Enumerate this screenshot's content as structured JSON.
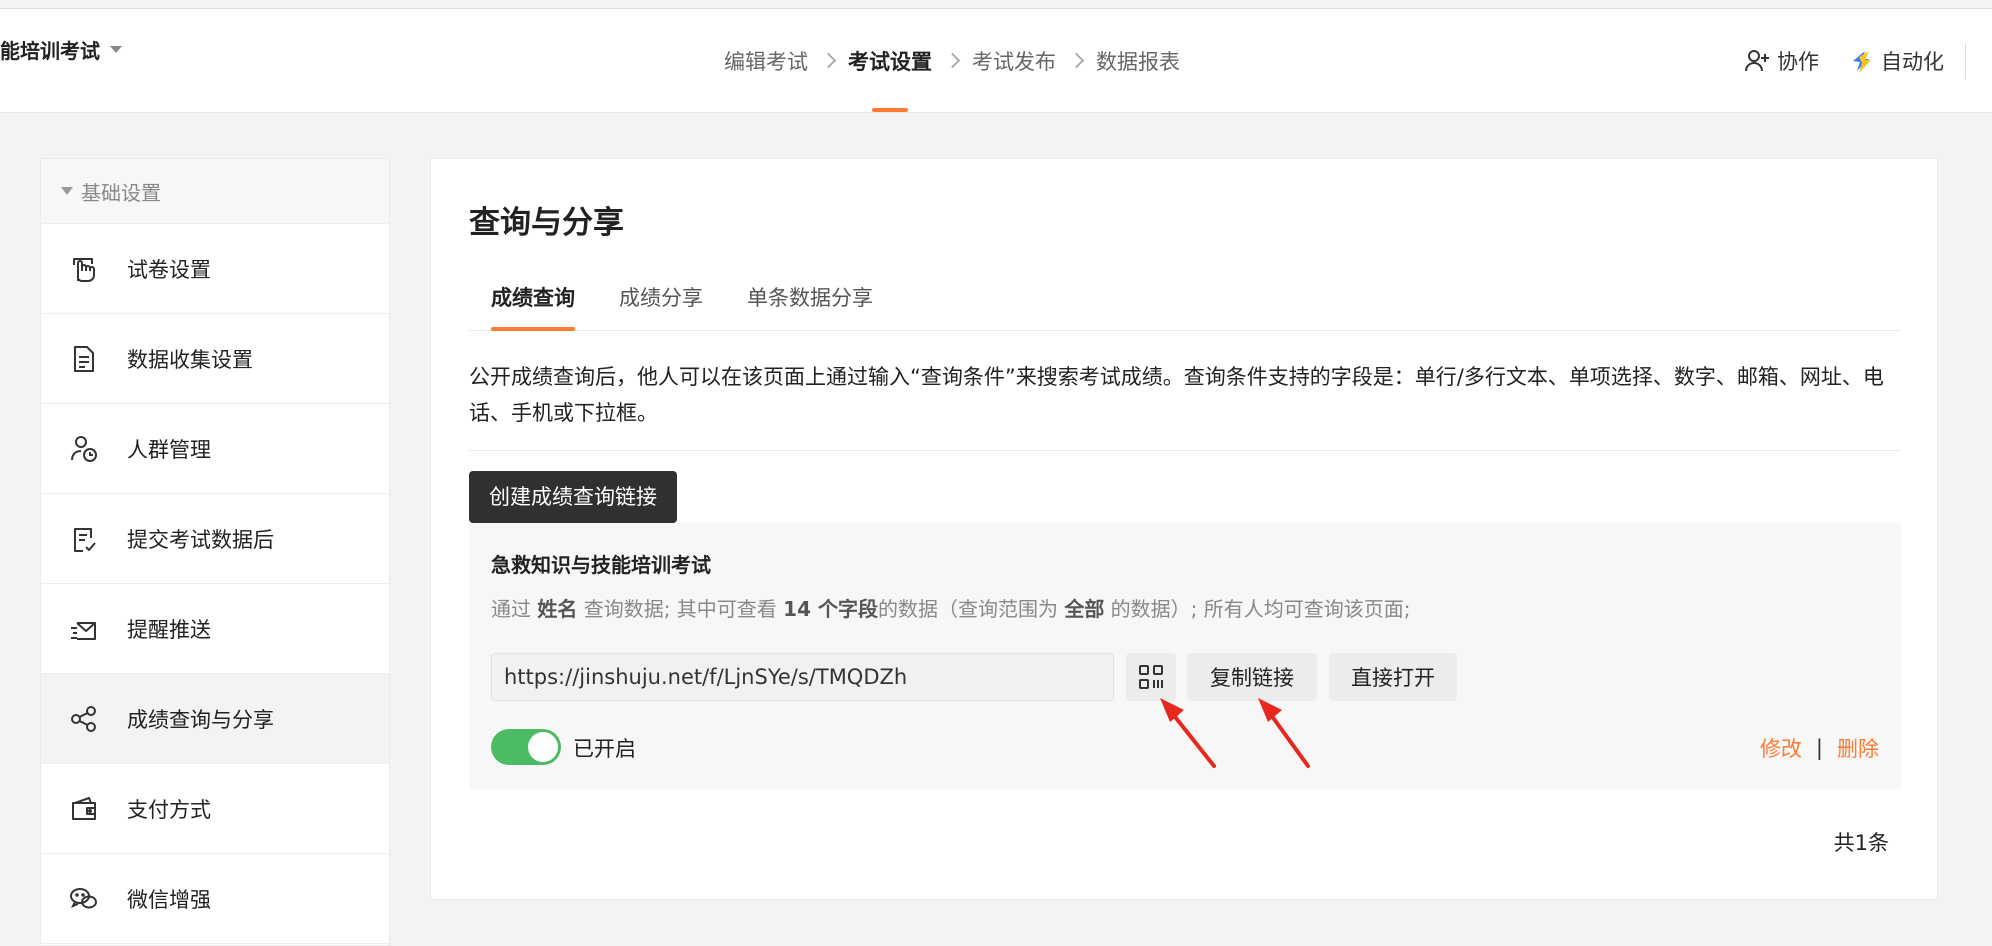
{
  "header": {
    "form_title": "能培训考试",
    "steps": [
      "编辑考试",
      "考试设置",
      "考试发布",
      "数据报表"
    ],
    "active_step": "考试设置",
    "actions": {
      "collab": "协作",
      "automation": "自动化"
    }
  },
  "sidebar": {
    "section": "基础设置",
    "items": [
      {
        "label": "试卷设置",
        "icon": "touch-hand-icon"
      },
      {
        "label": "数据收集设置",
        "icon": "document-icon"
      },
      {
        "label": "人群管理",
        "icon": "user-clock-icon"
      },
      {
        "label": "提交考试数据后",
        "icon": "document-check-icon"
      },
      {
        "label": "提醒推送",
        "icon": "envelope-send-icon"
      },
      {
        "label": "成绩查询与分享",
        "icon": "share-icon",
        "active": true
      },
      {
        "label": "支付方式",
        "icon": "wallet-icon"
      },
      {
        "label": "微信增强",
        "icon": "wechat-icon"
      }
    ]
  },
  "main": {
    "title": "查询与分享",
    "tabs": [
      "成绩查询",
      "成绩分享",
      "单条数据分享"
    ],
    "active_tab": "成绩查询",
    "description": "公开成绩查询后，他人可以在该页面上通过输入“查询条件”来搜索考试成绩。查询条件支持的字段是：单行/多行文本、单项选择、数字、邮箱、网址、电话、手机或下拉框。",
    "create_button": "创建成绩查询链接",
    "entry": {
      "title": "急救知识与技能培训考试",
      "sub_parts": {
        "p1": "通过 ",
        "b1": "姓名",
        "p2": " 查询数据; 其中可查看 ",
        "b2": "14 个字段",
        "p3": "的数据（查询范围为 ",
        "b3": "全部",
        "p4": " 的数据）; 所有人均可查询该页面;"
      },
      "url": "https://jinshuju.net/f/LjnSYe/s/TMQDZh",
      "copy_button": "复制链接",
      "open_button": "直接打开",
      "toggle_label": "已开启",
      "toggle_on": true,
      "edit": "修改",
      "separator": "|",
      "delete": "删除"
    },
    "total": "共1条"
  },
  "colors": {
    "accent": "#ff7a33",
    "toggle": "#4dbb63",
    "dark_button": "#303030",
    "arrow": "#e8281e"
  }
}
